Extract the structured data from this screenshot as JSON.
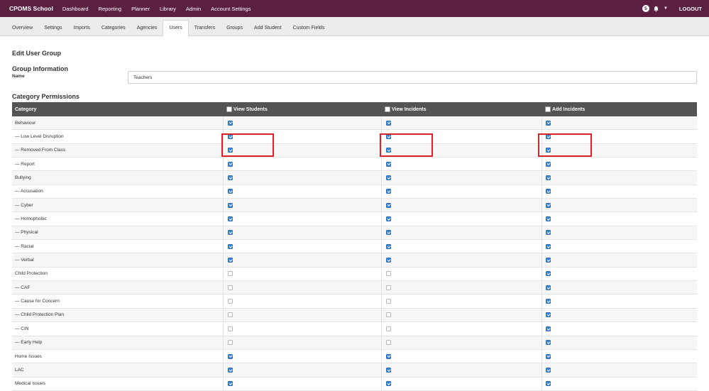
{
  "topnav": {
    "brand": "CPOMS School",
    "items": [
      "Dashboard",
      "Reporting",
      "Planner",
      "Library",
      "Admin",
      "Account Settings"
    ],
    "badge": "5",
    "logout": "LOGOUT"
  },
  "tabs": {
    "items": [
      "Overview",
      "Settings",
      "Imports",
      "Categories",
      "Agencies",
      "Users",
      "Transfers",
      "Groups",
      "Add Student",
      "Custom Fields"
    ],
    "active": "Users"
  },
  "page": {
    "title": "Edit User Group",
    "group_info": "Group Information",
    "name_label": "Name",
    "name_value": "Teachers",
    "permissions_title": "Category Permissions"
  },
  "table": {
    "headers": [
      "Category",
      "View Students",
      "View Incidents",
      "Add Incidents"
    ],
    "rows": [
      {
        "label": "Behaviour",
        "vs": true,
        "vi": true,
        "ai": true
      },
      {
        "label": "— Low Level Disruption",
        "vs": true,
        "vi": true,
        "ai": true
      },
      {
        "label": "— Removed From Class",
        "vs": true,
        "vi": true,
        "ai": true
      },
      {
        "label": "— Report",
        "vs": true,
        "vi": true,
        "ai": true
      },
      {
        "label": "Bullying",
        "vs": true,
        "vi": true,
        "ai": true
      },
      {
        "label": "— Accusation",
        "vs": true,
        "vi": true,
        "ai": true
      },
      {
        "label": "— Cyber",
        "vs": true,
        "vi": true,
        "ai": true
      },
      {
        "label": "— Homophobic",
        "vs": true,
        "vi": true,
        "ai": true
      },
      {
        "label": "— Physical",
        "vs": true,
        "vi": true,
        "ai": true
      },
      {
        "label": "— Racial",
        "vs": true,
        "vi": true,
        "ai": true
      },
      {
        "label": "— Verbal",
        "vs": true,
        "vi": true,
        "ai": true
      },
      {
        "label": "Child Protection",
        "vs": false,
        "vi": false,
        "ai": true
      },
      {
        "label": "— CAF",
        "vs": false,
        "vi": false,
        "ai": true
      },
      {
        "label": "— Cause for Concern",
        "vs": false,
        "vi": false,
        "ai": true
      },
      {
        "label": "— Child Protection Plan",
        "vs": false,
        "vi": false,
        "ai": true
      },
      {
        "label": "— CIN",
        "vs": false,
        "vi": false,
        "ai": true
      },
      {
        "label": "— Early Help",
        "vs": false,
        "vi": false,
        "ai": true
      },
      {
        "label": "Home Issues",
        "vs": true,
        "vi": true,
        "ai": true
      },
      {
        "label": "LAC",
        "vs": true,
        "vi": true,
        "ai": true
      },
      {
        "label": "Medical Issues",
        "vs": true,
        "vi": true,
        "ai": true
      }
    ]
  },
  "colors": {
    "topnav": "#5a1f41",
    "header_bg": "#545454",
    "checkbox_on": "#3b86d4",
    "highlight": "#d9232b"
  }
}
